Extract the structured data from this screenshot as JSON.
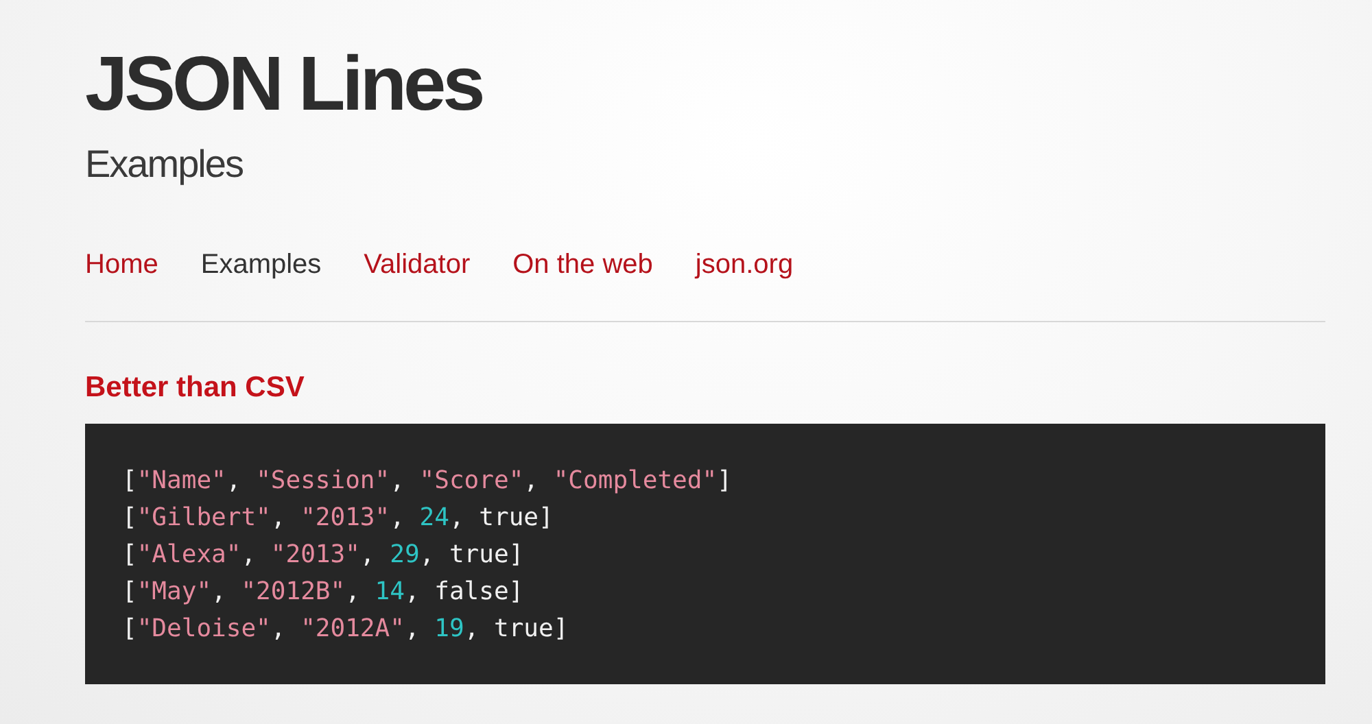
{
  "title": "JSON Lines",
  "subtitle": "Examples",
  "nav": [
    {
      "label": "Home",
      "selected": false
    },
    {
      "label": "Examples",
      "selected": true
    },
    {
      "label": "Validator",
      "selected": false
    },
    {
      "label": "On the web",
      "selected": false
    },
    {
      "label": "json.org",
      "selected": false
    }
  ],
  "section": {
    "heading": "Better than CSV",
    "code_lines": [
      [
        {
          "kind": "punct",
          "text": "["
        },
        {
          "kind": "string",
          "text": "\"Name\""
        },
        {
          "kind": "punct",
          "text": ", "
        },
        {
          "kind": "string",
          "text": "\"Session\""
        },
        {
          "kind": "punct",
          "text": ", "
        },
        {
          "kind": "string",
          "text": "\"Score\""
        },
        {
          "kind": "punct",
          "text": ", "
        },
        {
          "kind": "string",
          "text": "\"Completed\""
        },
        {
          "kind": "punct",
          "text": "]"
        }
      ],
      [
        {
          "kind": "punct",
          "text": "["
        },
        {
          "kind": "string",
          "text": "\"Gilbert\""
        },
        {
          "kind": "punct",
          "text": ", "
        },
        {
          "kind": "string",
          "text": "\"2013\""
        },
        {
          "kind": "punct",
          "text": ", "
        },
        {
          "kind": "number",
          "text": "24"
        },
        {
          "kind": "punct",
          "text": ", true]"
        }
      ],
      [
        {
          "kind": "punct",
          "text": "["
        },
        {
          "kind": "string",
          "text": "\"Alexa\""
        },
        {
          "kind": "punct",
          "text": ", "
        },
        {
          "kind": "string",
          "text": "\"2013\""
        },
        {
          "kind": "punct",
          "text": ", "
        },
        {
          "kind": "number",
          "text": "29"
        },
        {
          "kind": "punct",
          "text": ", true]"
        }
      ],
      [
        {
          "kind": "punct",
          "text": "["
        },
        {
          "kind": "string",
          "text": "\"May\""
        },
        {
          "kind": "punct",
          "text": ", "
        },
        {
          "kind": "string",
          "text": "\"2012B\""
        },
        {
          "kind": "punct",
          "text": ", "
        },
        {
          "kind": "number",
          "text": "14"
        },
        {
          "kind": "punct",
          "text": ", false]"
        }
      ],
      [
        {
          "kind": "punct",
          "text": "["
        },
        {
          "kind": "string",
          "text": "\"Deloise\""
        },
        {
          "kind": "punct",
          "text": ", "
        },
        {
          "kind": "string",
          "text": "\"2012A\""
        },
        {
          "kind": "punct",
          "text": ", "
        },
        {
          "kind": "number",
          "text": "19"
        },
        {
          "kind": "punct",
          "text": ", true]"
        }
      ]
    ]
  }
}
